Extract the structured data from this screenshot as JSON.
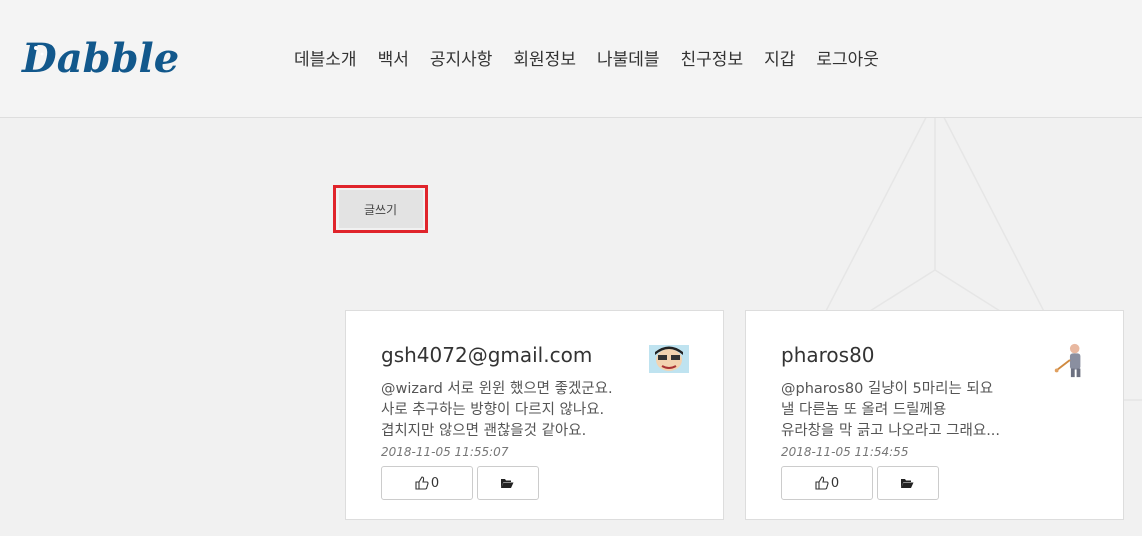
{
  "brand": {
    "logo_text": "Dabble"
  },
  "nav": {
    "items": [
      {
        "label": "데블소개"
      },
      {
        "label": "백서"
      },
      {
        "label": "공지사항"
      },
      {
        "label": "회원정보"
      },
      {
        "label": "나불데블"
      },
      {
        "label": "친구정보"
      },
      {
        "label": "지갑"
      },
      {
        "label": "로그아웃"
      }
    ]
  },
  "actions": {
    "write_label": "글쓰기"
  },
  "colors": {
    "brand": "#12588c",
    "highlight": "#e0242b",
    "background": "#f1f1f1"
  },
  "posts": [
    {
      "author": "gsh4072@gmail.com",
      "avatar_icon": "anime-face-avatar",
      "lines": [
        "@wizard 서로 윈윈 했으면 좋겠군요.",
        "사로 추구하는 방향이 다르지 않나요.",
        "겹치지만 않으면 괜찮을것 같아요."
      ],
      "date": "2018-11-05 11:55:07",
      "likes": "0",
      "like_icon": "thumbs-up-icon",
      "folder_icon": "folder-open-icon"
    },
    {
      "author": "pharos80",
      "avatar_icon": "person-figure-avatar",
      "lines": [
        "@pharos80 길냥이 5마리는 되요",
        "낼 다른놈 또 올려 드릴께용",
        "유라창을 막 긁고 나오라고 그래요..."
      ],
      "date": "2018-11-05 11:54:55",
      "likes": "0",
      "like_icon": "thumbs-up-icon",
      "folder_icon": "folder-open-icon"
    }
  ]
}
